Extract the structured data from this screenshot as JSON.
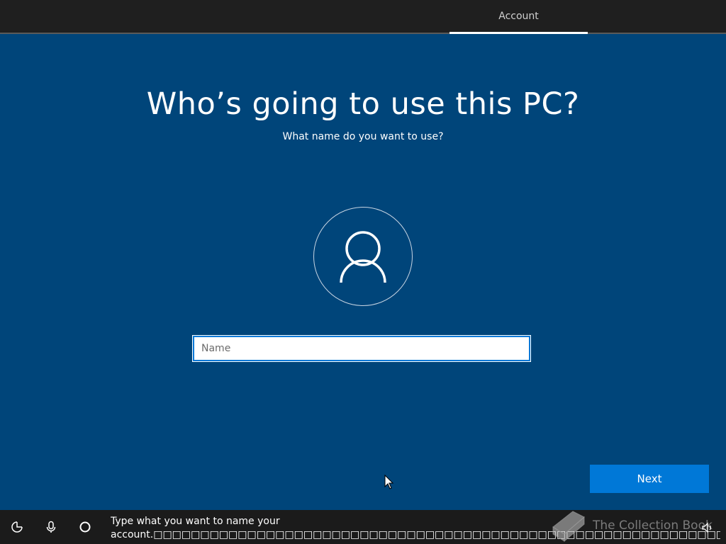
{
  "header": {
    "active_tab": "Account"
  },
  "main": {
    "title": "Who’s going to use this PC?",
    "subtitle": "What name do you want to use?",
    "avatar_icon": "user-icon",
    "name_field": {
      "placeholder": "Name",
      "value": ""
    },
    "next_label": "Next"
  },
  "taskbar": {
    "icons": [
      "ease-of-access-icon",
      "microphone-icon",
      "cortana-icon",
      "volume-icon"
    ],
    "narration_line1": "Type what you want to name your",
    "narration_line2": "account.□□□□□□□□□□□□□□□□□□□□□□□□□□□□□□□□□□□□□□□□□□□□□□□□□□□□□□□□□□□□□□□□□□□□□□□□□□□□□□□□□□□□□□□□□□□□□□□□□□□"
  },
  "watermark": {
    "text": "The Collection Book"
  },
  "colors": {
    "background": "#00457a",
    "accent": "#0078d7",
    "topbar": "#1f1f1f",
    "bottombar": "#1b1b1b"
  }
}
